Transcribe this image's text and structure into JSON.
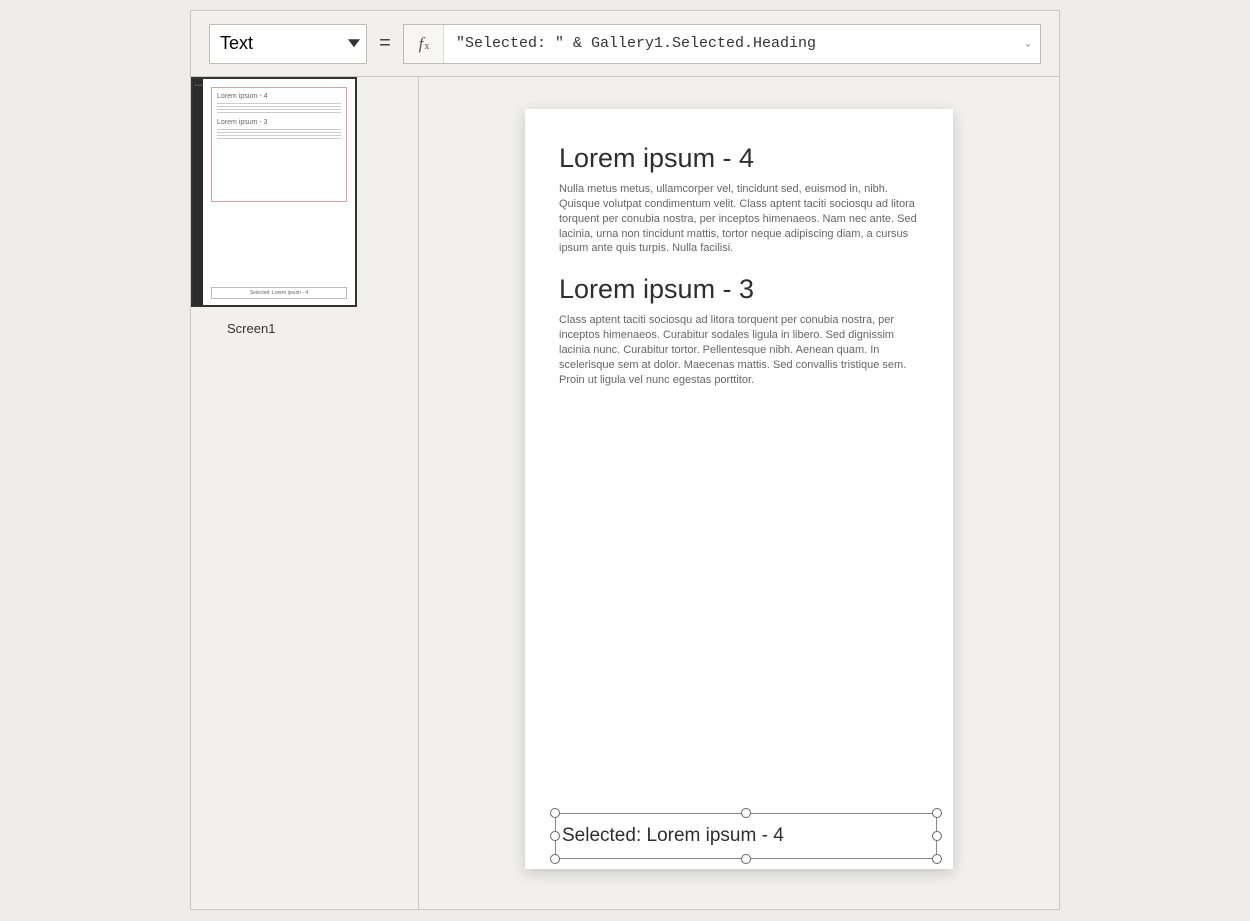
{
  "formulaBar": {
    "property": "Text",
    "equals": "=",
    "fx": "fx",
    "formula": "\"Selected: \" & Gallery1.Selected.Heading"
  },
  "screensPanel": {
    "screenName": "Screen1",
    "thumb": {
      "item1": "Lorem ipsum - 4",
      "item2": "Lorem ipsum - 3",
      "selectedMini": "Selected: Lorem ipsum - 4"
    }
  },
  "canvas": {
    "gallery": [
      {
        "heading": "Lorem ipsum - 4",
        "body": "Nulla metus metus, ullamcorper vel, tincidunt sed, euismod in, nibh. Quisque volutpat condimentum velit. Class aptent taciti sociosqu ad litora torquent per conubia nostra, per inceptos himenaeos. Nam nec ante. Sed lacinia, urna non tincidunt mattis, tortor neque adipiscing diam, a cursus ipsum ante quis turpis. Nulla facilisi."
      },
      {
        "heading": "Lorem ipsum - 3",
        "body": "Class aptent taciti sociosqu ad litora torquent per conubia nostra, per inceptos himenaeos. Curabitur sodales ligula in libero. Sed dignissim lacinia nunc. Curabitur tortor. Pellentesque nibh. Aenean quam. In scelerisque sem at dolor. Maecenas mattis. Sed convallis tristique sem. Proin ut ligula vel nunc egestas porttitor."
      }
    ],
    "selectedLabel": "Selected: Lorem ipsum - 4"
  }
}
